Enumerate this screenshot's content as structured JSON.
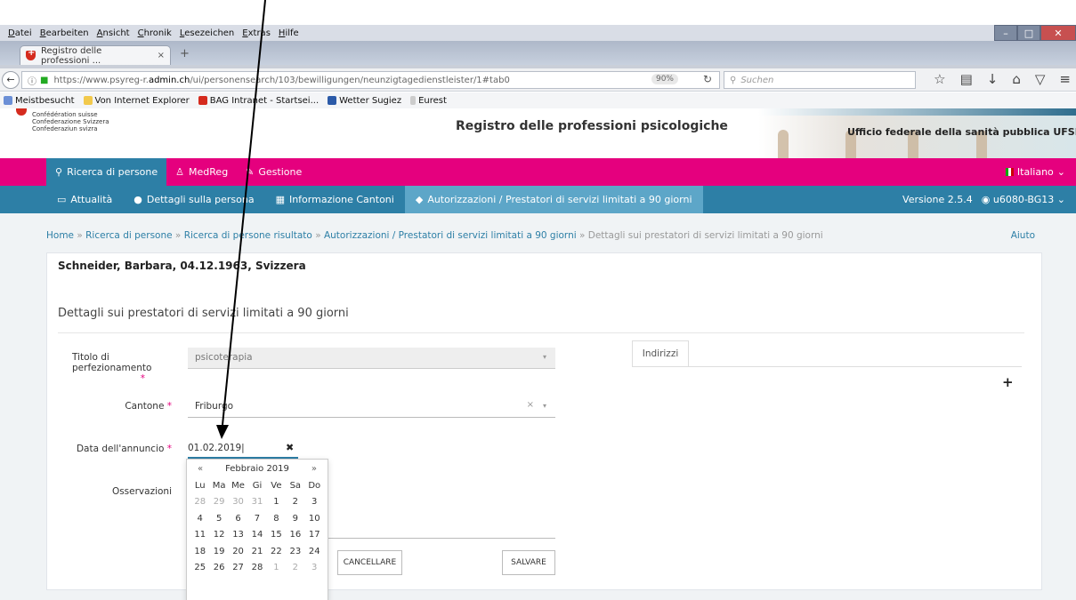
{
  "browser": {
    "menu": [
      "Datei",
      "Bearbeiten",
      "Ansicht",
      "Chronik",
      "Lesezeichen",
      "Extras",
      "Hilfe"
    ],
    "tab_title": "Registro delle professioni ...",
    "url_prefix": "https://www.psyreg-r.",
    "url_domain": "admin.ch",
    "url_suffix": "/ui/personensearch/103/bewilligungen/neunzigtagedienstleister/1#tab0",
    "zoom": "90%",
    "search_placeholder": "Suchen",
    "bookmarks": [
      "Meistbesucht",
      "Von Internet Explorer",
      "BAG Intranet - Startsei...",
      "Wetter Sugiez",
      "Eurest"
    ]
  },
  "header": {
    "confed_lines": [
      "Confédération suisse",
      "Confederazione Svizzera",
      "Confederaziun svizra"
    ],
    "site_title": "Registro delle professioni psicologiche",
    "office": "Ufficio federale della sanità pubblica UFSP"
  },
  "pinkbar": {
    "items": [
      "Ricerca di persone",
      "MedReg",
      "Gestione"
    ],
    "language": "Italiano"
  },
  "bluebar": {
    "items": [
      "Attualità",
      "Dettagli sulla persona",
      "Informazione Cantoni",
      "Autorizzazioni / Prestatori di servizi limitati a 90 giorni"
    ],
    "version": "Versione 2.5.4",
    "user": "u6080-BG13"
  },
  "breadcrumb": {
    "items": [
      "Home",
      "Ricerca di persone",
      "Ricerca di persone risultato",
      "Autorizzazioni / Prestatori di servizi limitati a 90 giorni"
    ],
    "current": "Dettagli sui prestatori di servizi limitati a 90 giorni",
    "help": "Aiuto"
  },
  "form": {
    "person": "Schneider, Barbara, 04.12.1963, Svizzera",
    "section_title": "Dettagli sui prestatori di servizi limitati a 90 giorni",
    "titolo_label": "Titolo di perfezionamento",
    "titolo_value": "psicoterapia",
    "cantone_label": "Cantone",
    "cantone_value": "Friburgo",
    "data_label": "Data dell'annuncio",
    "data_value": "01.02.2019",
    "osservazioni_label": "Osservazioni",
    "cancel": "CANCELLARE",
    "save": "SALVARE",
    "addr_tab": "Indirizzi",
    "required": "*"
  },
  "datepicker": {
    "prev": "«",
    "next": "»",
    "month": "Febbraio 2019",
    "weekdays": [
      "Lu",
      "Ma",
      "Me",
      "Gi",
      "Ve",
      "Sa",
      "Do"
    ],
    "weeks": [
      [
        "28",
        "29",
        "30",
        "31",
        "1",
        "2",
        "3"
      ],
      [
        "4",
        "5",
        "6",
        "7",
        "8",
        "9",
        "10"
      ],
      [
        "11",
        "12",
        "13",
        "14",
        "15",
        "16",
        "17"
      ],
      [
        "18",
        "19",
        "20",
        "21",
        "22",
        "23",
        "24"
      ],
      [
        "25",
        "26",
        "27",
        "28",
        "1",
        "2",
        "3"
      ]
    ]
  }
}
